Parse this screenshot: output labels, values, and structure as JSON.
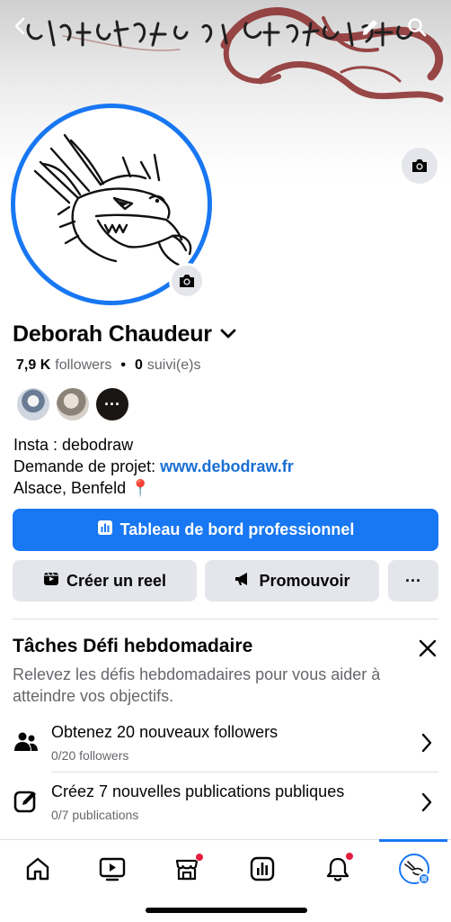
{
  "profile": {
    "name": "Deborah Chaudeur",
    "followers_count": "7,9 K",
    "followers_label": "followers",
    "following_count": "0",
    "following_label": "suivi(e)s",
    "separator": "•",
    "friend_more": "···"
  },
  "bio": {
    "line1": "Insta : debodraw",
    "line2_prefix": "Demande de projet: ",
    "line2_link": "www.debodraw.fr",
    "line3": "Alsace, Benfeld",
    "line3_emoji": "📍"
  },
  "actions": {
    "dashboard": "Tableau de bord professionnel",
    "create_reel": "Créer un reel",
    "promote": "Promouvoir",
    "more": "···"
  },
  "challenges": {
    "title": "Tâches Défi hebdomadaire",
    "description": "Relevez les défis hebdomadaires pour vous aider à atteindre vos objectifs.",
    "tasks": [
      {
        "title": "Obtenez 20 nouveaux followers",
        "progress": "0/20 followers",
        "icon": "people-icon"
      },
      {
        "title": "Créez 7 nouvelles publications publiques",
        "progress": "0/7 publications",
        "icon": "compose-icon"
      }
    ]
  },
  "nav": {
    "items": [
      "home-icon",
      "video-icon",
      "marketplace-icon",
      "dashboard-icon",
      "bell-icon",
      "profile-avatar"
    ],
    "active": "profile-avatar"
  },
  "colors": {
    "accent": "#1877f2",
    "link": "#1a6fd3",
    "badge": "#e41e3f",
    "secondary_button": "#e4e6eb"
  }
}
